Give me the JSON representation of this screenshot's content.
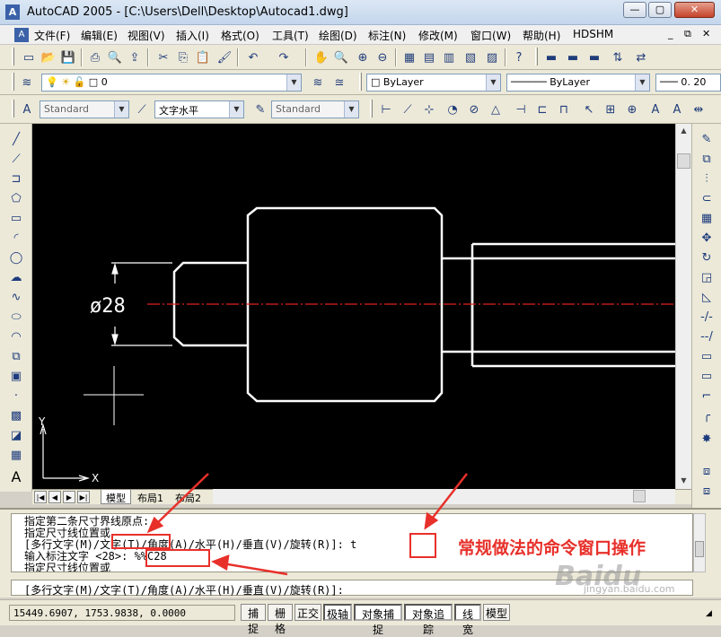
{
  "window": {
    "title": "AutoCAD 2005 - [C:\\Users\\Dell\\Desktop\\Autocad1.dwg]",
    "app_icon": "autocad-icon",
    "doc_icon": "drawing-doc-icon"
  },
  "menu": [
    "文件(F)",
    "编辑(E)",
    "视图(V)",
    "插入(I)",
    "格式(O)",
    "工具(T)",
    "绘图(D)",
    "标注(N)",
    "修改(M)",
    "窗口(W)",
    "帮助(H)",
    "HDSHM"
  ],
  "layers": {
    "layer_value": "0",
    "color_value": "ByLayer",
    "linetype_value": "ByLayer",
    "lineweight_value": "0. 20"
  },
  "styles": {
    "text_style": "Standard",
    "dim_style_label": "文字水平",
    "table_style": "Standard"
  },
  "drawing": {
    "dimension_text": "ø28",
    "ucs_y": "Y",
    "ucs_x": "X",
    "background": "#000000",
    "centerline_color": "#e0201c",
    "geometry_color": "#ffffff"
  },
  "layout_tabs": [
    "模型",
    "布局1",
    "布局2"
  ],
  "command": {
    "history": [
      "指定第二条尺寸界线原点:",
      "指定尺寸线位置或",
      "[多行文字(M)/文字(T)/角度(A)/水平(H)/垂直(V)/旋转(R)]: t",
      "输入标注文字 <28>: %%C28",
      "指定尺寸线位置或"
    ],
    "current_prompt": "[多行文字(M)/文字(T)/角度(A)/水平(H)/垂直(V)/旋转(R)]:",
    "annotation": "常规做法的命令窗口操作",
    "annotation_color": "#e8302a"
  },
  "status": {
    "coordinates": "15449.6907, 1753.9838, 0.0000",
    "toggles": [
      "捕捉",
      "栅格",
      "正交",
      "极轴",
      "对象捕捉",
      "对象追踪",
      "线宽",
      "模型"
    ]
  },
  "watermark": {
    "brand": "Baidu",
    "sub": "jingyan.baidu.com"
  }
}
